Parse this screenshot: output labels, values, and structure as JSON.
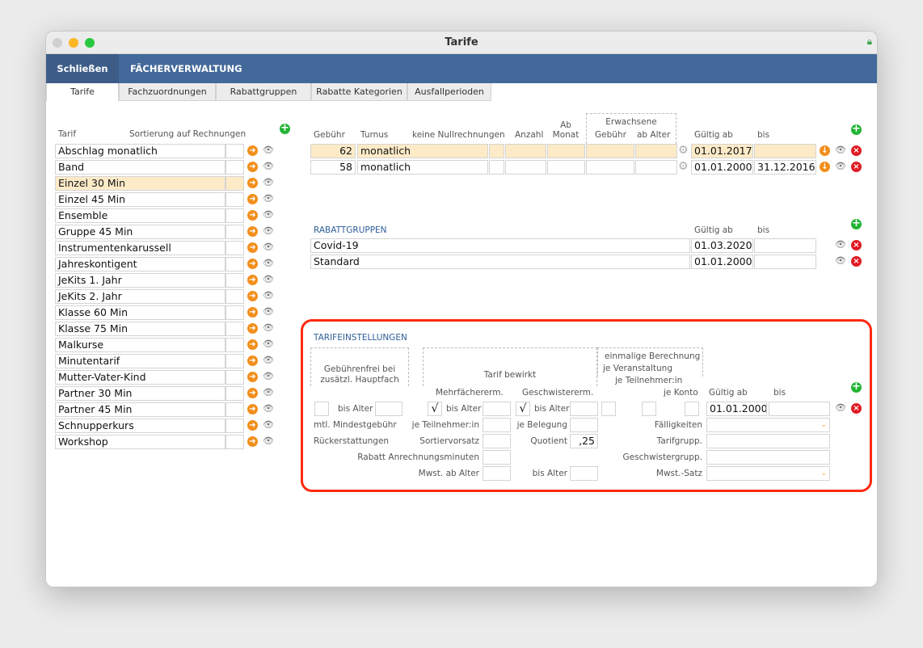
{
  "window": {
    "title": "Tarife"
  },
  "nav": {
    "close": "Schließen",
    "title": "FÄCHERVERWALTUNG"
  },
  "tabs": [
    "Tarife",
    "Fachzuordnungen",
    "Rabattgruppen",
    "Rabatte Kategorien",
    "Ausfallperioden"
  ],
  "tarif_list": {
    "col_tarif": "Tarif",
    "col_sort": "Sortierung auf Rechnungen",
    "selected": "Einzel 30 Min",
    "items": [
      "Abschlag monatlich",
      "Band",
      "Einzel 30 Min",
      "Einzel 45 Min",
      "Ensemble",
      "Gruppe 45 Min",
      "Instrumentenkarussell",
      "Jahreskontigent",
      "JeKits 1. Jahr",
      "JeKits 2. Jahr",
      "Klasse 60 Min",
      "Klasse 75 Min",
      "Malkurse",
      "Minutentarif",
      "Mutter-Vater-Kind",
      "Partner 30 Min",
      "Partner 45 Min",
      "Schnupperkurs",
      "Workshop"
    ]
  },
  "fees": {
    "headers": {
      "gebuehr": "Gebühr",
      "turnus": "Turnus",
      "keine_null": "keine Nullrechnungen",
      "anzahl": "Anzahl",
      "ab_monat": "Ab Monat",
      "erwachsene": "Erwachsene",
      "erw_gebuehr": "Gebühr",
      "ab_alter": "ab Alter",
      "gueltig_ab": "Gültig ab",
      "bis": "bis"
    },
    "rows": [
      {
        "gebuehr": "62",
        "turnus": "monatlich",
        "gueltig_ab": "01.01.2017",
        "bis": ""
      },
      {
        "gebuehr": "58",
        "turnus": "monatlich",
        "gueltig_ab": "01.01.2000",
        "bis": "31.12.2016"
      }
    ]
  },
  "rabattgruppen": {
    "title": "RABATTGRUPPEN",
    "gueltig_ab": "Gültig ab",
    "bis": "bis",
    "rows": [
      {
        "name": "Covid-19",
        "gueltig_ab": "01.03.2020",
        "bis": ""
      },
      {
        "name": "Standard",
        "gueltig_ab": "01.01.2000",
        "bis": ""
      }
    ]
  },
  "settings": {
    "title": "TARIFEINSTELLUNGEN",
    "gebuehrenfrei": "Gebührenfrei bei zusätzl. Hauptfach",
    "tarif_bewirkt": "Tarif bewirkt",
    "mehrfach": "Mehrfächererm.",
    "geschwister": "Geschwistererm.",
    "einmalig": "einmalige Berechnung",
    "je_veranstaltung": "je Veranstaltung",
    "je_teilnehmer_h": "je Teilnehmer:in",
    "je_konto": "je Konto",
    "gueltig_ab": "Gültig ab",
    "bis": "bis",
    "bis_alter": "bis Alter",
    "gueltig_value": "01.01.2000",
    "mehrfach_checked": true,
    "geschwister_checked": true,
    "mindest": "mtl. Mindestgebühr",
    "je_teilnehmer": "je Teilnehmer:in",
    "je_belegung": "je Belegung",
    "faelligkeiten": "Fälligkeiten",
    "rueck": "Rückerstattungen",
    "sortiervorsatz": "Sortiervorsatz",
    "quotient": "Quotient",
    "quotient_value": ",25",
    "tarifgrupp": "Tarifgrupp.",
    "rabatt_min": "Rabatt Anrechnungsminuten",
    "geschwistergrupp": "Geschwistergrupp.",
    "mwst_ab": "Mwst. ab Alter",
    "mwst_bis": "bis Alter",
    "mwst_satz": "Mwst.-Satz",
    "check": "√"
  },
  "colors": {
    "nav": "#43699b",
    "highlight": "#fdebc8",
    "frame": "#ff2a10"
  }
}
